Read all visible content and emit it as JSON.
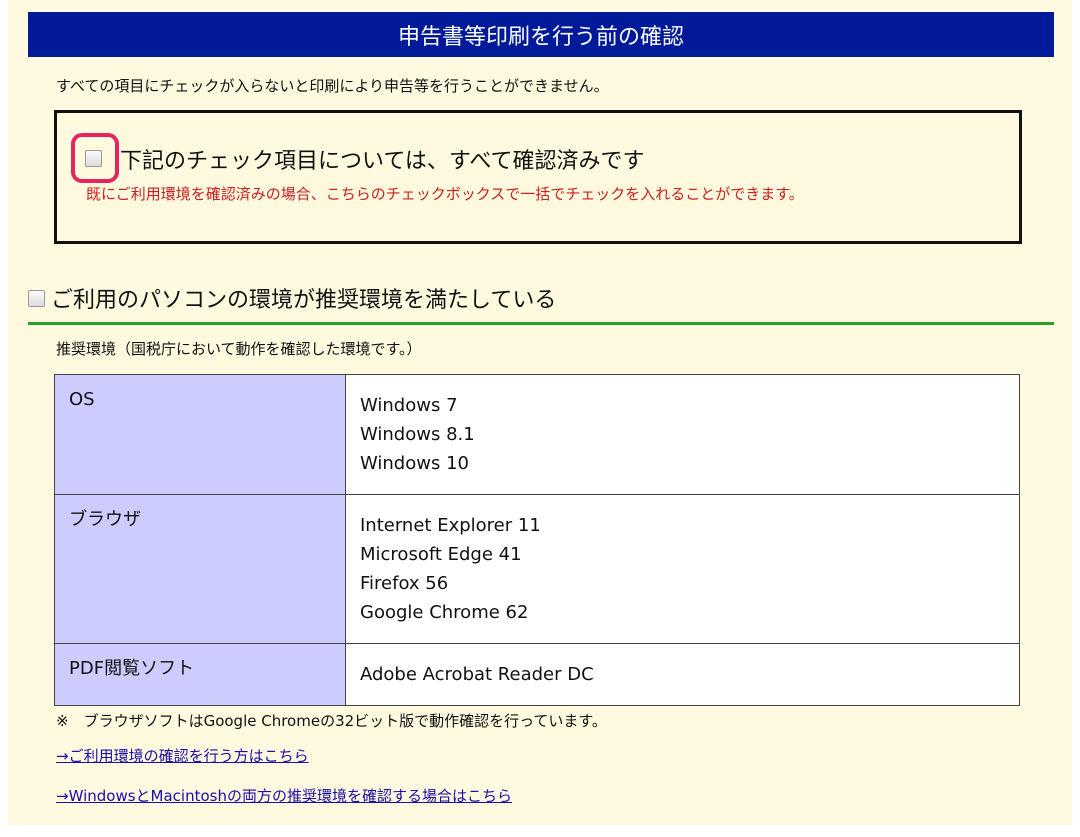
{
  "header": {
    "title": "申告書等印刷を行う前の確認"
  },
  "intro": "すべての項目にチェックが入らないと印刷により申告等を行うことができません。",
  "bulk_check": {
    "label": "下記のチェック項目については、すべて確認済みです",
    "note": "既にご利用環境を確認済みの場合、こちらのチェックボックスで一括でチェックを入れることができます。",
    "checked": false,
    "highlight_color": "#e8245c"
  },
  "env_section": {
    "title": "ご利用のパソコンの環境が推奨環境を満たしている",
    "checked": false,
    "subtext": "推奨環境（国税庁において動作を確認した環境です。）",
    "rows": [
      {
        "key": "OS",
        "values": [
          "Windows 7",
          "Windows 8.1",
          "Windows 10"
        ]
      },
      {
        "key": "ブラウザ",
        "values": [
          "Internet Explorer 11",
          "Microsoft Edge 41",
          "Firefox 56",
          "Google Chrome 62"
        ]
      },
      {
        "key": "PDF閲覧ソフト",
        "values": [
          "Adobe Acrobat Reader DC"
        ]
      }
    ],
    "footnote": "※　ブラウザソフトはGoogle Chromeの32ビット版で動作確認を行っています。",
    "links": [
      "→ご利用環境の確認を行う方はこちら",
      "→WindowsとMacintoshの両方の推奨環境を確認する場合はこちら"
    ]
  },
  "colors": {
    "header_bg": "#001a99",
    "page_bg": "#fff9e0",
    "key_cell_bg": "#ccccff",
    "note_red": "#cc1f1f",
    "section_rule": "#2aa12a",
    "link": "#1a0dab"
  }
}
